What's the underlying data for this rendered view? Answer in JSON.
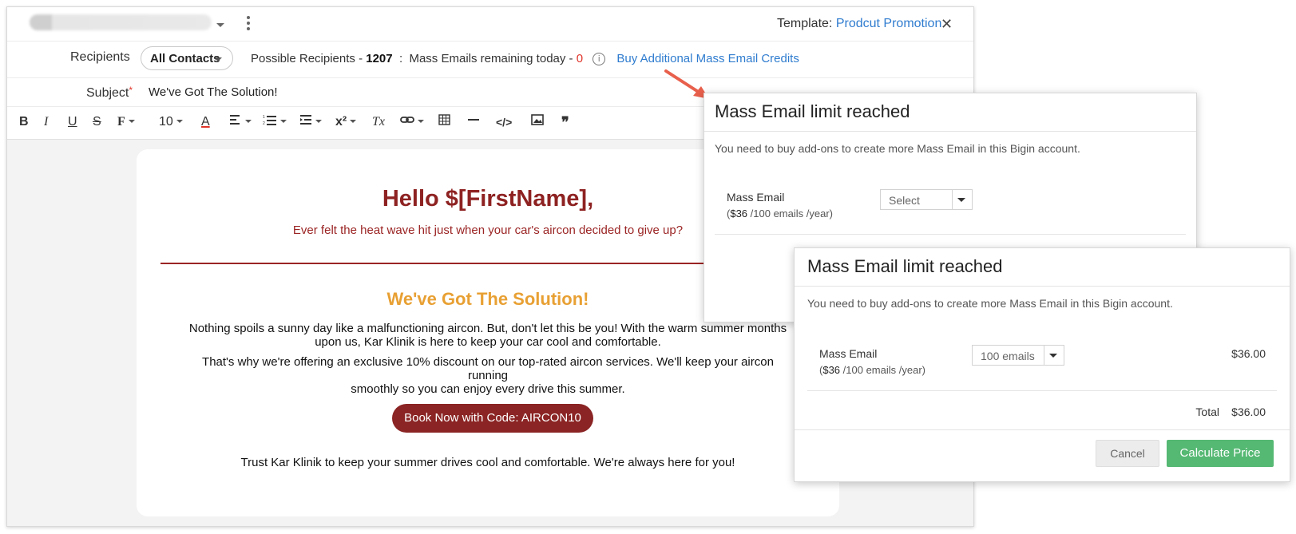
{
  "header": {
    "template_prefix": "Template:",
    "template_name": "Prodcut Promotion",
    "close_glyph": "✕"
  },
  "recipients": {
    "label": "Recipients",
    "selected": "All Contacts",
    "possible_label": "Possible Recipients -",
    "possible_count": "1207",
    "separator": ":",
    "remaining_label": "Mass Emails remaining today -",
    "remaining_count": "0",
    "info_glyph": "i",
    "buy_link": "Buy Additional Mass Email Credits"
  },
  "subject": {
    "label": "Subject",
    "required_mark": "*",
    "value": "We've Got The Solution!"
  },
  "toolbar": {
    "bold": "B",
    "italic": "I",
    "underline": "U",
    "strike": "S",
    "font": "F",
    "font_size": "10",
    "font_color": "A",
    "superscript": "x²",
    "clear_format": "Tx",
    "code": "</>",
    "quote": "❞"
  },
  "email": {
    "greeting": "Hello $[FirstName],",
    "tagline": "Ever felt the heat wave hit just when your car's aircon decided to give up?",
    "heading": "We've Got The Solution!",
    "para1_line1": "Nothing spoils a sunny day like a malfunctioning aircon. But, don't let this be you! With the warm summer months",
    "para1_line2": "upon us, Kar Klinik is here to keep your car cool and comfortable.",
    "para2_line1": "That's why we're offering an exclusive 10% discount on our top-rated aircon services. We'll keep your aircon running",
    "para2_line2": "smoothly so you can enjoy every drive this summer.",
    "cta": "Book Now with Code: AIRCON10",
    "closing": "Trust Kar Klinik to keep your summer drives cool and comfortable. We're always here for you!"
  },
  "modal_back": {
    "title": "Mass Email limit reached",
    "description": "You need to buy add-ons to create more Mass Email in this Bigin account.",
    "item_name": "Mass Email",
    "price_open": "(",
    "price_value": "$36",
    "price_rest": " /100 emails /year)",
    "select_value": "Select"
  },
  "modal_front": {
    "title": "Mass Email limit reached",
    "description": "You need to buy add-ons to create more Mass Email in this Bigin account.",
    "item_name": "Mass Email",
    "price_open": "(",
    "price_value": "$36",
    "price_rest": " /100 emails /year)",
    "select_value": "100 emails",
    "line_amount": "$36.00",
    "total_label": "Total",
    "total_amount": "$36.00",
    "cancel_label": "Cancel",
    "calculate_label": "Calculate Price"
  },
  "colors": {
    "link": "#2f7ccf",
    "brand_red": "#8e2222",
    "accent_orange": "#e8a033",
    "calc_green": "#55b873",
    "annotation_arrow": "#e8604c"
  }
}
